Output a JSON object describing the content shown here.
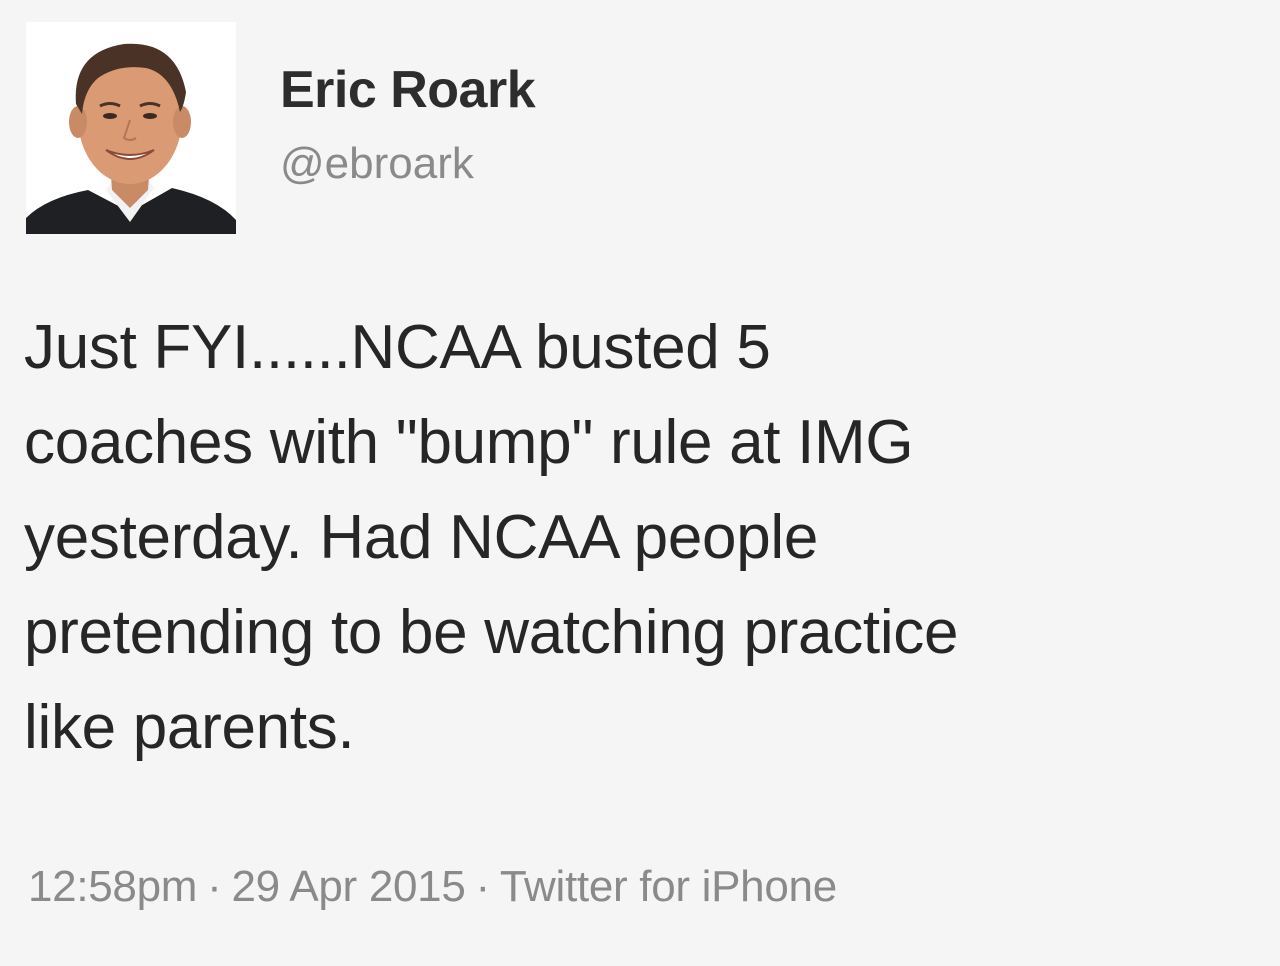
{
  "author": {
    "name": "Eric Roark",
    "handle": "@ebroark"
  },
  "tweet": {
    "lines": [
      "Just FYI......NCAA busted 5",
      "coaches with \"bump\" rule at IMG",
      "yesterday. Had NCAA people",
      "pretending to be watching practice",
      "like parents."
    ]
  },
  "meta": {
    "time": "12:58pm",
    "separator": "·",
    "date": "29 Apr 2015",
    "source": "Twitter for iPhone"
  },
  "colors": {
    "background": "#f5f5f5",
    "name": "#2d2d2d",
    "muted": "#8a8a8a",
    "text": "#262626"
  }
}
